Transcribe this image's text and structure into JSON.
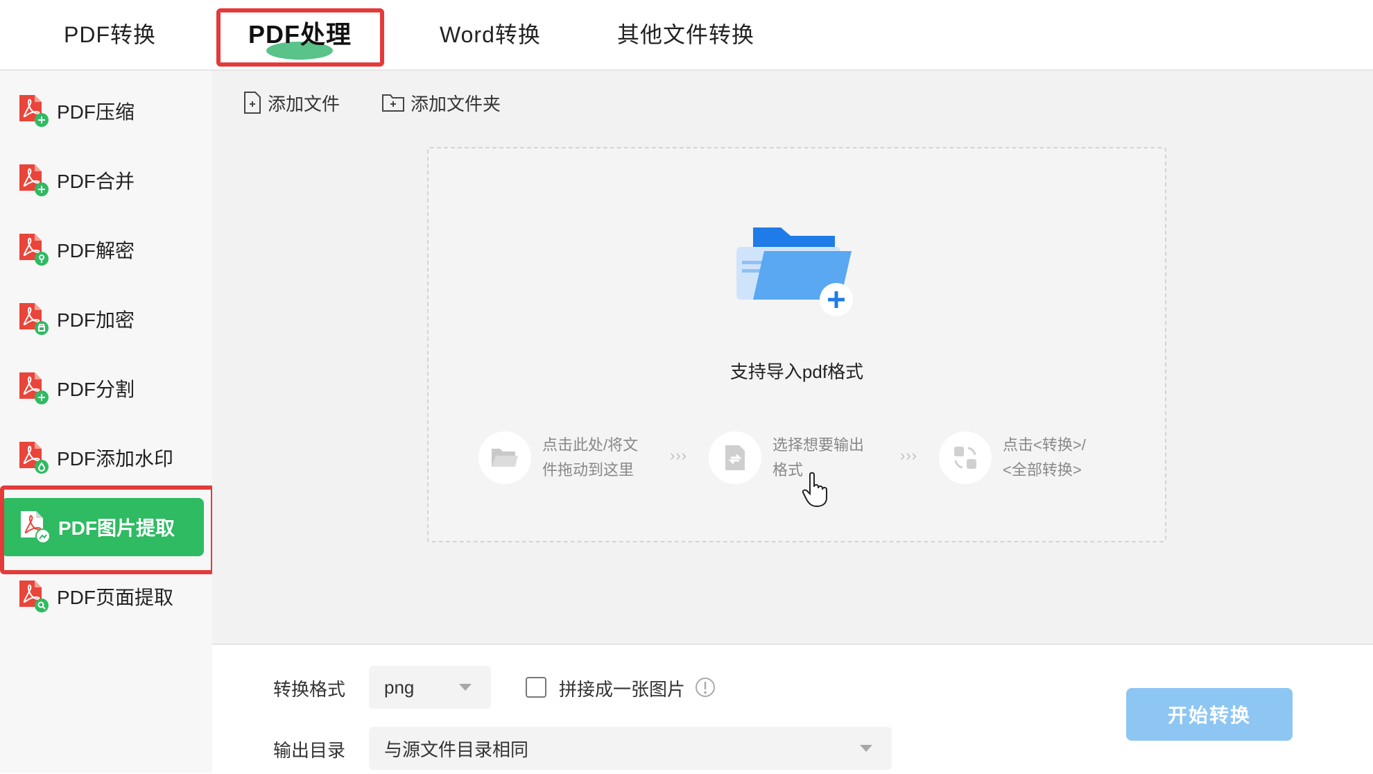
{
  "top_tabs": [
    {
      "label": "PDF转换"
    },
    {
      "label": "PDF处理",
      "active": true
    },
    {
      "label": "Word转换"
    },
    {
      "label": "其他文件转换"
    }
  ],
  "sidebar": {
    "items": [
      {
        "label": "PDF压缩",
        "icon": "pdf-compress-icon"
      },
      {
        "label": "PDF合并",
        "icon": "pdf-merge-icon"
      },
      {
        "label": "PDF解密",
        "icon": "pdf-decrypt-icon"
      },
      {
        "label": "PDF加密",
        "icon": "pdf-encrypt-icon"
      },
      {
        "label": "PDF分割",
        "icon": "pdf-split-icon"
      },
      {
        "label": "PDF添加水印",
        "icon": "pdf-watermark-icon"
      },
      {
        "label": "PDF图片提取",
        "icon": "pdf-image-extract-icon",
        "active": true
      },
      {
        "label": "PDF页面提取",
        "icon": "pdf-page-extract-icon"
      }
    ]
  },
  "toolbar": {
    "add_file": "添加文件",
    "add_folder": "添加文件夹"
  },
  "dropzone": {
    "support_text": "支持导入pdf格式",
    "steps": [
      {
        "line1": "点击此处/将文",
        "line2": "件拖动到这里"
      },
      {
        "line1": "选择想要输出",
        "line2": "格式"
      },
      {
        "line1": "点击<转换>/",
        "line2": "<全部转换>"
      }
    ],
    "separator": "›››"
  },
  "settings": {
    "format_label": "转换格式",
    "format_value": "png",
    "merge_label": "拼接成一张图片",
    "output_label": "输出目录",
    "output_value": "与源文件目录相同",
    "start_button": "开始转换"
  },
  "colors": {
    "accent_green": "#2ebb62",
    "annotation_red": "#e43a3a",
    "start_button_blue": "#8ec6f3",
    "folder_blue": "#1f7be8"
  }
}
